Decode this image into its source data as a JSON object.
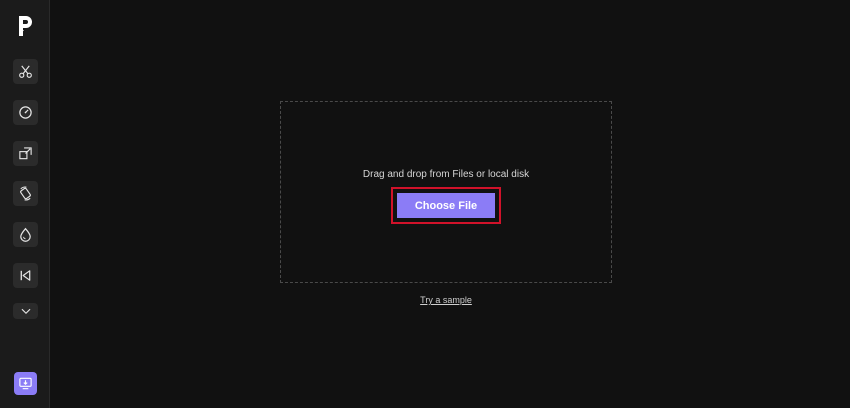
{
  "sidebar": {
    "logo_icon": "p-logo-icon",
    "tools": [
      {
        "name": "cut",
        "icon": "scissors-icon"
      },
      {
        "name": "speed",
        "icon": "speedometer-icon"
      },
      {
        "name": "resize",
        "icon": "resize-icon"
      },
      {
        "name": "rotate",
        "icon": "rotate-icon"
      },
      {
        "name": "watermark",
        "icon": "drop-icon"
      },
      {
        "name": "reverse",
        "icon": "skip-back-icon"
      },
      {
        "name": "more",
        "icon": "chevron-down-icon"
      }
    ],
    "bottom_tool": {
      "name": "screen-record",
      "icon": "monitor-download-icon"
    }
  },
  "upload": {
    "instruction": "Drag and drop from Files or local disk",
    "choose_label": "Choose File",
    "sample_label": "Try a sample"
  },
  "colors": {
    "background": "#111111",
    "sidebar": "#1b1b1b",
    "accent": "#8b7cf6",
    "highlight": "#d1122a"
  }
}
